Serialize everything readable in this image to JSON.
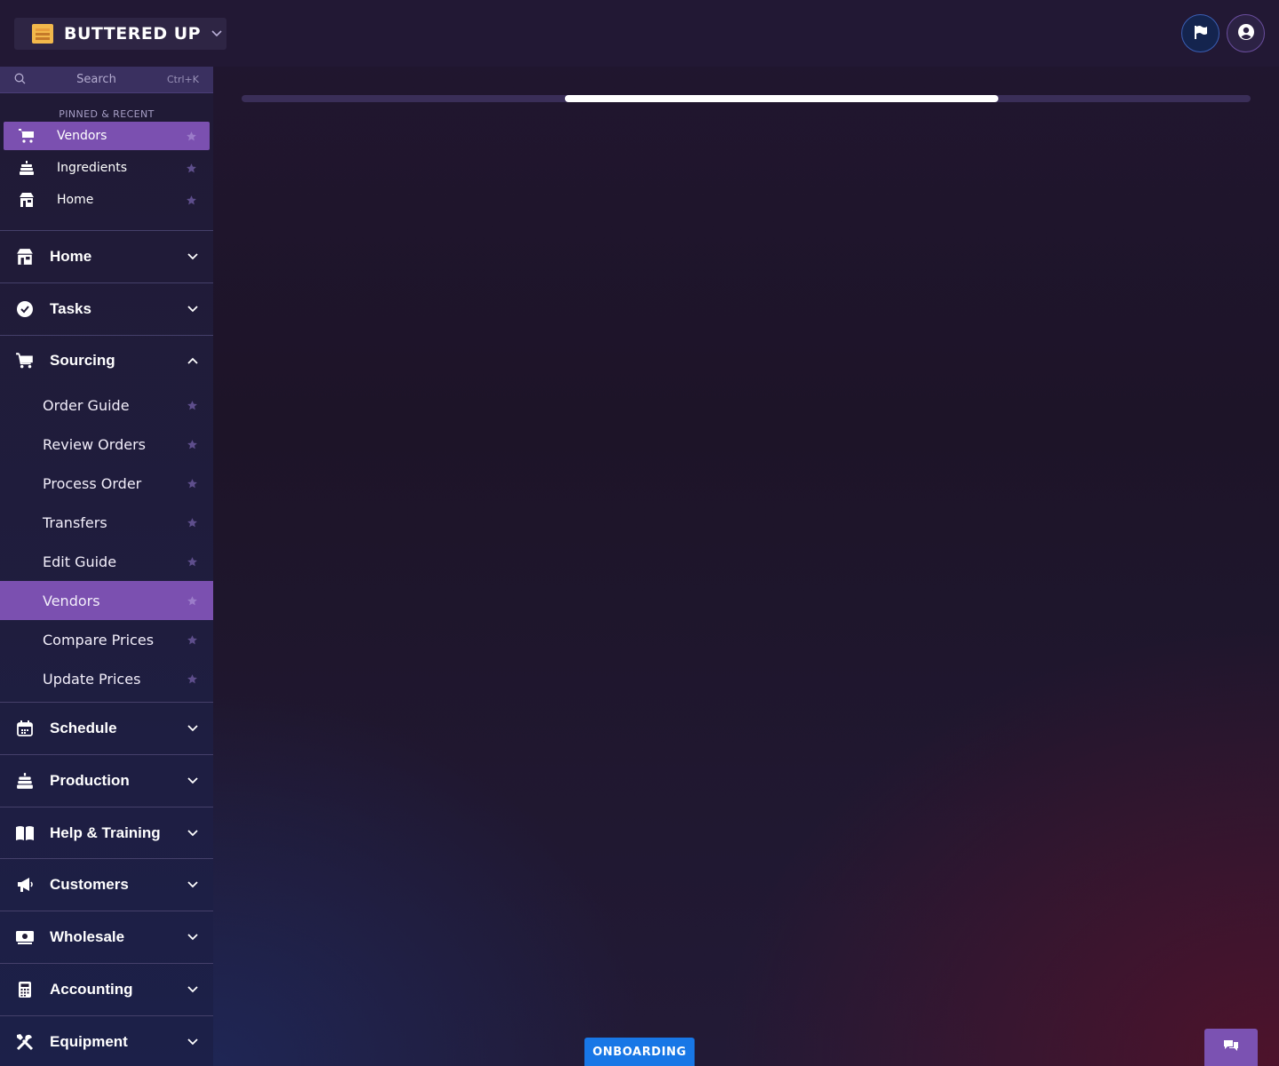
{
  "brand": {
    "name": "BUTTERED UP",
    "logo_icon": "bakery-logo-icon"
  },
  "header": {
    "flag_icon": "flag-icon",
    "user_icon": "user-circle-icon"
  },
  "search": {
    "label": "Search",
    "shortcut": "Ctrl+K"
  },
  "pinned": {
    "title": "PINNED & RECENT",
    "items": [
      {
        "label": "Vendors",
        "icon": "cart-icon",
        "active": true
      },
      {
        "label": "Ingredients",
        "icon": "cake-icon",
        "active": false
      },
      {
        "label": "Home",
        "icon": "store-icon",
        "active": false
      }
    ]
  },
  "nav": {
    "home": "Home",
    "tasks": "Tasks",
    "sourcing": "Sourcing",
    "sourcing_items": [
      "Order Guide",
      "Review Orders",
      "Process Order",
      "Transfers",
      "Edit Guide",
      "Vendors",
      "Compare Prices",
      "Update Prices"
    ],
    "sourcing_active_index": 5,
    "schedule": "Schedule",
    "production": "Production",
    "help": "Help & Training",
    "customers": "Customers",
    "wholesale": "Wholesale",
    "accounting": "Accounting",
    "equipment": "Equipment"
  },
  "loading": {
    "progress_start": 0.32,
    "progress_end": 0.75
  },
  "footer": {
    "onboarding": "ONBOARDING",
    "chat_icon": "chat-icon"
  },
  "colors": {
    "accent": "#7b50b0",
    "onboarding": "#1877e6",
    "sidebar_bg": "#201a35"
  }
}
